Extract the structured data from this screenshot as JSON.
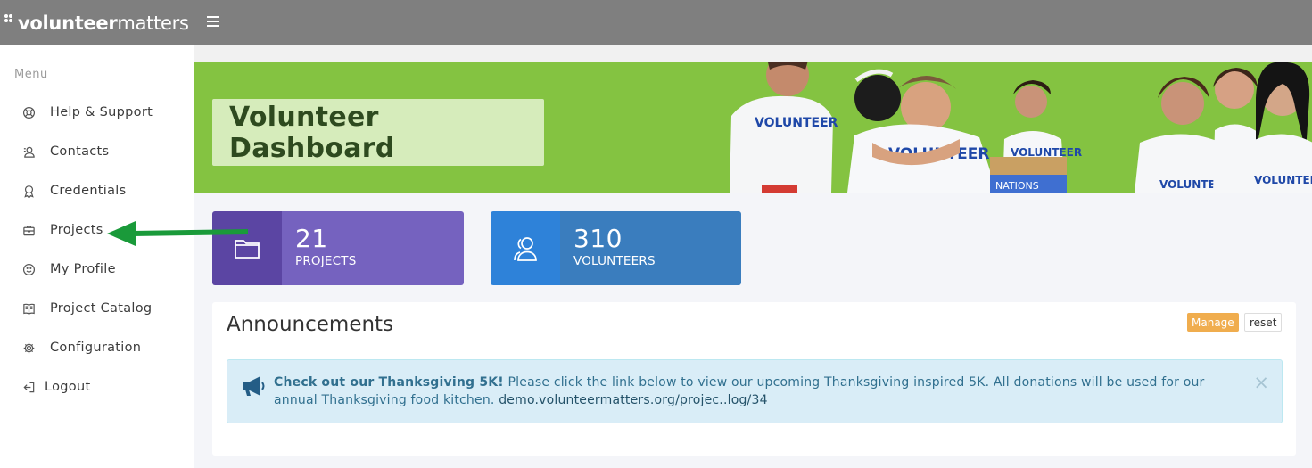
{
  "topbar": {
    "logo_bold": "volunteer",
    "logo_light": "matters",
    "menu_toggle_icon": "hamburger-icon",
    "background": "#7f7f7f"
  },
  "sidebar": {
    "heading": "Menu",
    "items": [
      {
        "label": "Help & Support",
        "icon": "lifebuoy-icon"
      },
      {
        "label": "Contacts",
        "icon": "contact-icon"
      },
      {
        "label": "Credentials",
        "icon": "award-icon"
      },
      {
        "label": "Projects",
        "icon": "briefcase-icon"
      },
      {
        "label": "My Profile",
        "icon": "smiley-icon"
      },
      {
        "label": "Project Catalog",
        "icon": "book-icon"
      },
      {
        "label": "Configuration",
        "icon": "gear-icon"
      },
      {
        "label": "Logout",
        "icon": "logout-icon"
      }
    ]
  },
  "banner": {
    "title": "Volunteer Dashboard",
    "shirt_text": "VOLUNTEER",
    "box_text": "NATIONS",
    "background": "#84c341"
  },
  "stats": [
    {
      "value": "21",
      "label": "PROJECTS",
      "icon": "folder-icon",
      "icon_bg": "#5b45a3",
      "body_bg": "#7562bf"
    },
    {
      "value": "310",
      "label": "VOLUNTEERS",
      "icon": "users-icon",
      "icon_bg": "#2e82d9",
      "body_bg": "#3a7dbe"
    }
  ],
  "announcements": {
    "title": "Announcements",
    "manage_label": "Manage",
    "reset_label": "reset",
    "alert": {
      "icon": "megaphone-icon",
      "headline": "Check out our Thanksgiving 5K!",
      "body": " Please click the link below to view our upcoming Thanksgiving inspired 5K. All donations will be used for our annual Thanksgiving food kitchen. ",
      "link": "demo.volunteermatters.org/projec..log/34",
      "close": "×"
    }
  },
  "annotation": {
    "arrow_color": "#1a9a3a",
    "points_to": "Projects"
  }
}
